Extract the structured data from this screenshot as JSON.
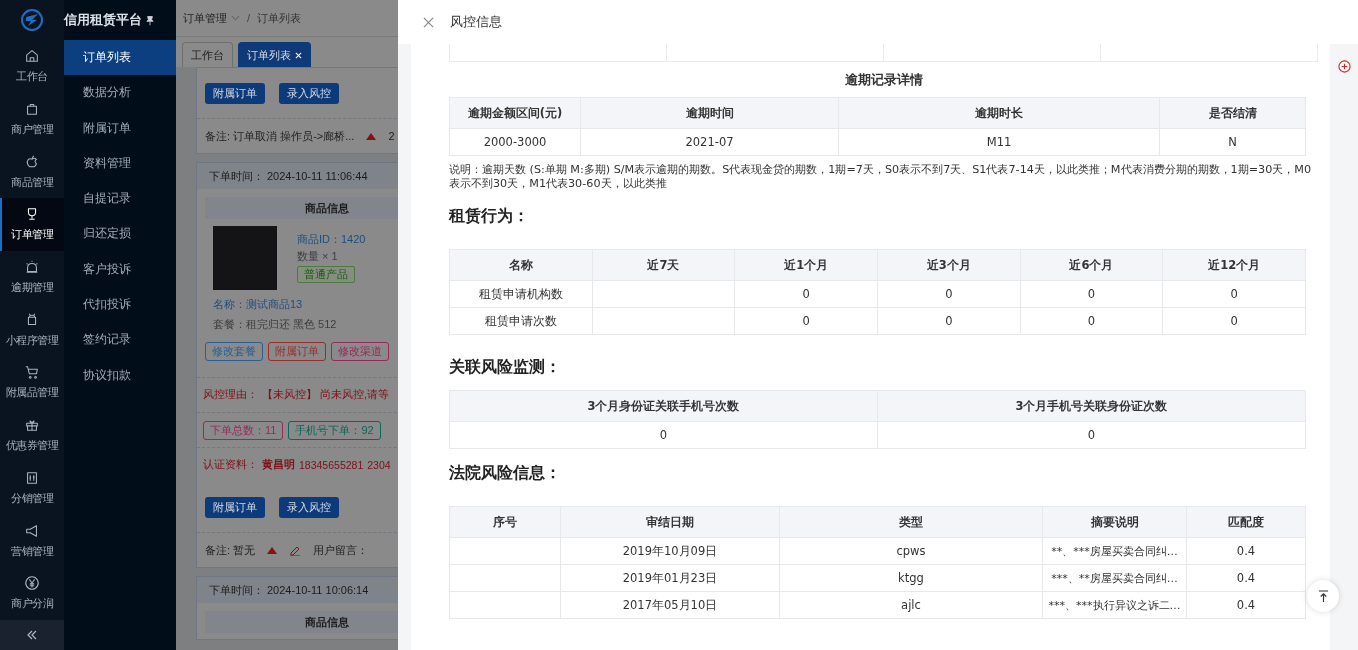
{
  "sidebar": {
    "brand": "信用租赁平台",
    "items": [
      {
        "label": "工作台",
        "selected": false
      },
      {
        "label": "商户管理",
        "selected": false
      },
      {
        "label": "商品管理",
        "selected": false
      },
      {
        "label": "订单管理",
        "selected": true
      },
      {
        "label": "逾期管理",
        "selected": false
      },
      {
        "label": "小程序管理",
        "selected": false
      },
      {
        "label": "附属品管理",
        "selected": false
      },
      {
        "label": "优惠券管理",
        "selected": false
      },
      {
        "label": "分销管理",
        "selected": false
      },
      {
        "label": "营销管理",
        "selected": false
      },
      {
        "label": "商户分润",
        "selected": false
      }
    ],
    "submenu": [
      {
        "label": "订单列表",
        "selected": true
      },
      {
        "label": "数据分析",
        "selected": false
      },
      {
        "label": "附属订单",
        "selected": false
      },
      {
        "label": "资料管理",
        "selected": false
      },
      {
        "label": "自提记录",
        "selected": false
      },
      {
        "label": "归还定损",
        "selected": false
      },
      {
        "label": "客户投诉",
        "selected": false
      },
      {
        "label": "代扣投诉",
        "selected": false
      },
      {
        "label": "签约记录",
        "selected": false
      },
      {
        "label": "协议扣款",
        "selected": false
      }
    ]
  },
  "background_page": {
    "breadcrumb": [
      "订单管理",
      "订单列表"
    ],
    "breadcrumb_separator": "/",
    "tabs": [
      {
        "label": "工作台",
        "selected": false,
        "closable": false
      },
      {
        "label": "订单列表",
        "selected": true,
        "closable": true
      }
    ],
    "top_actions": [
      "附属订单",
      "录入风控"
    ],
    "top_remark": "备注: 订单取消 操作员->廊桥...",
    "top_remark_extra": "2",
    "order": {
      "time_label": "下单时间：",
      "time": "2024-10-11 11:06:44",
      "product_header": "商品信息",
      "product_id": "商品ID：1420",
      "quantity": "数量 × 1",
      "tag": "普通产品",
      "name_label": "名称：",
      "name": "测试商品13",
      "package": "套餐：租完归还 黑色 512",
      "product_actions": [
        {
          "label": "修改套餐",
          "color": "#2a5f96"
        },
        {
          "label": "附属订单",
          "color": "#9a2c2c"
        },
        {
          "label": "修改渠道",
          "color": "#962a5a"
        }
      ],
      "risk_label": "风控理由：",
      "risk_text": "【未风控】 尚未风控,请等",
      "stats": [
        {
          "label": "下单总数：",
          "value": "11",
          "color": "#962a5a"
        },
        {
          "label": "手机号下单：",
          "value": "92",
          "color": "#0e6656"
        }
      ],
      "auth_label": "认证资料：",
      "auth_name": "黄昌明",
      "auth_phone": "18345655281",
      "auth_id": "2304",
      "actions": [
        "附属订单",
        "录入风控"
      ],
      "remark": "备注: 暂无",
      "message_label": "用户留言："
    },
    "next_order": {
      "time_label": "下单时间：",
      "time": "2024-10-11 10:06:14",
      "product_header": "商品信息"
    }
  },
  "drawer": {
    "title": "风控信息",
    "overdue": {
      "title": "逾期记录详情",
      "columns": [
        "逾期金额区间(元)",
        "逾期时间",
        "逾期时长",
        "是否结清"
      ],
      "rows": [
        [
          "2000-3000",
          "2021-07",
          "M11",
          "N"
        ]
      ],
      "note": "说明：逾期天数 (S:单期 M:多期) S/M表示逾期的期数。S代表现金贷的期数，1期=7天，S0表示不到7天、S1代表7-14天，以此类推；M代表消费分期的期数，1期=30天，M0表示不到30天，M1代表30-60天，以此类推"
    },
    "rental": {
      "heading": "租赁行为：",
      "columns": [
        "名称",
        "近7天",
        "近1个月",
        "近3个月",
        "近6个月",
        "近12个月"
      ],
      "rows": [
        {
          "name": "租赁申请机构数",
          "values": [
            "0",
            "0",
            "0",
            "0"
          ]
        },
        {
          "name": "租赁申请次数",
          "values": [
            "0",
            "0",
            "0",
            "0"
          ]
        }
      ]
    },
    "related": {
      "heading": "关联风险监测：",
      "columns": [
        "3个月身份证关联手机号次数",
        "3个月手机号关联身份证次数"
      ],
      "rows": [
        [
          "0",
          "0"
        ]
      ]
    },
    "court": {
      "heading": "法院风险信息：",
      "columns": [
        "序号",
        "审结日期",
        "类型",
        "摘要说明",
        "匹配度"
      ],
      "rows": [
        {
          "date": "2019年10月09日",
          "type": "cpws",
          "summary": "**、***房屋买卖合同纠…",
          "match": "0.4"
        },
        {
          "date": "2019年01月23日",
          "type": "ktgg",
          "summary": "***、**房屋买卖合同纠…",
          "match": "0.4"
        },
        {
          "date": "2017年05月10日",
          "type": "ajlc",
          "summary": "***、***执行异议之诉二…",
          "match": "0.4"
        }
      ]
    }
  }
}
